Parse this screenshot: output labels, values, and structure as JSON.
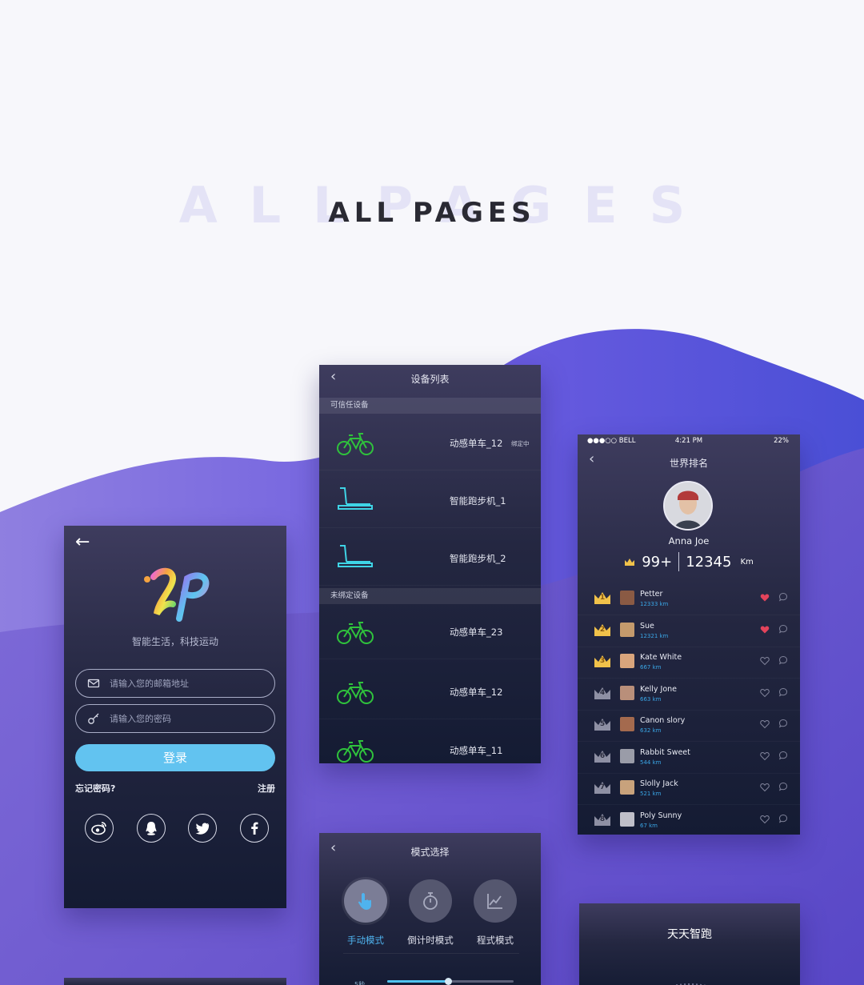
{
  "hero": {
    "shadow": "ALLPAGES",
    "title": "ALL PAGES"
  },
  "colors": {
    "accent": "#62c3f0",
    "brand_purple": "#5b4fd3",
    "bike_green": "#2fc23c",
    "treadmill_cyan": "#3fd4e6",
    "heart_red": "#e3435b",
    "crown_gold": "#f1c24a",
    "crown_gray": "#8e90a4"
  },
  "login": {
    "back_icon": "back-arrow-icon",
    "slogan": "智能生活，科技运动",
    "email_placeholder": "请输入您的邮箱地址",
    "password_placeholder": "请输入您的密码",
    "login_label": "登录",
    "forgot_label": "忘记密码?",
    "register_label": "注册",
    "socials": [
      "weibo-icon",
      "qq-icon",
      "twitter-icon",
      "facebook-icon"
    ]
  },
  "devices": {
    "title": "设备列表",
    "trusted_header": "可信任设备",
    "unbound_header": "未绑定设备",
    "trusted": [
      {
        "name": "动感单车_12",
        "type": "bike",
        "badge": "绑定中"
      },
      {
        "name": "智能跑步机_1",
        "type": "treadmill",
        "badge": ""
      },
      {
        "name": "智能跑步机_2",
        "type": "treadmill",
        "badge": ""
      }
    ],
    "unbound": [
      {
        "name": "动感单车_23",
        "type": "bike"
      },
      {
        "name": "动感单车_12",
        "type": "bike"
      },
      {
        "name": "动感单车_11",
        "type": "bike"
      }
    ]
  },
  "ranking": {
    "status": {
      "carrier": "●●●○○ BELL",
      "time": "4:21 PM",
      "battery": "22%"
    },
    "title": "世界排名",
    "user": {
      "name": "Anna Joe",
      "rank": "99+",
      "distance": "12345",
      "unit": "Km"
    },
    "rows": [
      {
        "rank": "1",
        "name": "Petter",
        "km": "12333 km",
        "liked": true
      },
      {
        "rank": "2",
        "name": "Sue",
        "km": "12321 km",
        "liked": true
      },
      {
        "rank": "3",
        "name": "Kate White",
        "km": "667 km",
        "liked": false
      },
      {
        "rank": "4",
        "name": "Kelly Jone",
        "km": "663 km",
        "liked": false
      },
      {
        "rank": "5",
        "name": "Canon slory",
        "km": "632 km",
        "liked": false
      },
      {
        "rank": "6",
        "name": "Rabbit Sweet",
        "km": "544 km",
        "liked": false
      },
      {
        "rank": "7",
        "name": "Slolly Jack",
        "km": "521 km",
        "liked": false
      },
      {
        "rank": "8",
        "name": "Poly Sunny",
        "km": "67 km",
        "liked": false
      }
    ]
  },
  "mode": {
    "title": "模式选择",
    "items": [
      {
        "label": "手动模式",
        "icon": "hand-pointer-icon",
        "active": true
      },
      {
        "label": "倒计时模式",
        "icon": "stopwatch-icon",
        "active": false
      },
      {
        "label": "程式模式",
        "icon": "line-chart-icon",
        "active": false
      }
    ],
    "slider_label": "5秒",
    "slider_value": 0.48
  },
  "daily": {
    "title": "天天智跑"
  }
}
